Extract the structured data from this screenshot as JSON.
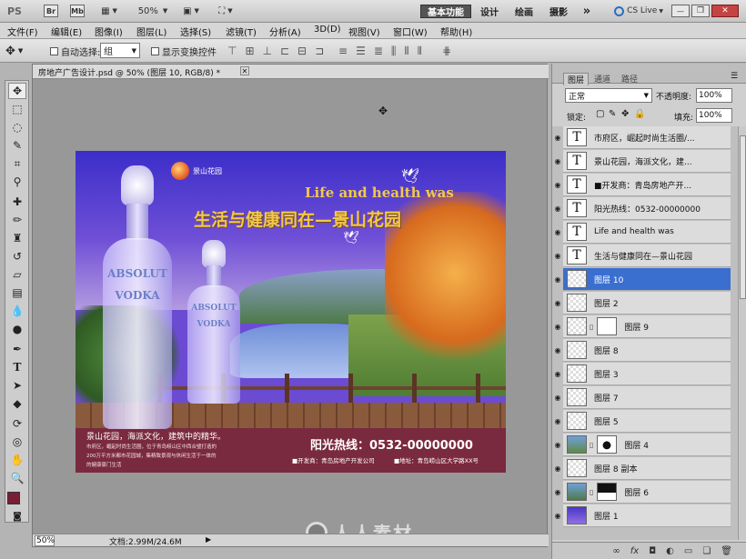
{
  "appbar": {
    "logo": "PS",
    "br": "Br",
    "mb": "Mb",
    "zoom": "50%",
    "workspaces": [
      "基本功能",
      "设计",
      "绘画",
      "摄影"
    ],
    "more": "»",
    "cslive": "CS Live",
    "min": "—",
    "restore": "❐",
    "close": "✕"
  },
  "menu": [
    "文件(F)",
    "编辑(E)",
    "图像(I)",
    "图层(L)",
    "选择(S)",
    "滤镜(T)",
    "分析(A)",
    "3D(D)",
    "视图(V)",
    "窗口(W)",
    "帮助(H)"
  ],
  "options": {
    "auto_select_label": "自动选择:",
    "auto_select_value": "组",
    "show_transform_label": "显示变换控件"
  },
  "doc": {
    "tab_title": "房地产广告设计.psd @ 50% (图层 10, RGB/8) *",
    "tab_close": "✕",
    "zoom": "50%",
    "doc_size": "文档:2.99M/24.6M"
  },
  "ad": {
    "logo_text": "景山花园",
    "headline_en": "Life and health was",
    "headline_cn": "生活与健康同在—景山花园",
    "bottle_big_brand": "ABSOLUT",
    "bottle_big_sub": "VODKA",
    "bottle_small_brand": "ABSOLUT",
    "bottle_small_sub": "VODKA",
    "slogan": "景山花园，海派文化，建筑中的精华。",
    "desc_lines": [
      "市府区，崛起时尚生活圈，位于青岛崂山区中西合璧打造的",
      "200万平方米都市花园城，集精致景观与休闲生活于一体的",
      "的健康豪门生活"
    ],
    "hotline": "阳光热线：0532-00000000",
    "developer": "■开发商：青岛房地产开发公司",
    "address": "■地址：青岛崂山区大学路XX号"
  },
  "panel": {
    "tabs": [
      "图层",
      "通道",
      "路径"
    ],
    "blend_mode": "正常",
    "opacity_label": "不透明度:",
    "opacity_value": "100%",
    "lock_label": "锁定:",
    "fill_label": "填充:",
    "fill_value": "100%",
    "layers": [
      {
        "name": "市府区，崛起时尚生活圈/...",
        "kind": "text"
      },
      {
        "name": "景山花园，海派文化，建...",
        "kind": "text"
      },
      {
        "name": "■开发商：青岛房地产开...",
        "kind": "text"
      },
      {
        "name": "阳光热线：0532-00000000",
        "kind": "text"
      },
      {
        "name": "Life and health was",
        "kind": "text"
      },
      {
        "name": "生活与健康同在—景山花园",
        "kind": "text"
      },
      {
        "name": "图层 10",
        "kind": "pixel",
        "selected": true
      },
      {
        "name": "图层 2",
        "kind": "pixel"
      },
      {
        "name": "图层 9",
        "kind": "mask"
      },
      {
        "name": "图层 8",
        "kind": "pixel"
      },
      {
        "name": "图层 3",
        "kind": "pixel"
      },
      {
        "name": "图层 7",
        "kind": "pixel"
      },
      {
        "name": "图层 5",
        "kind": "pixel"
      },
      {
        "name": "图层 4",
        "kind": "mask"
      },
      {
        "name": "图层 8 副本",
        "kind": "pixel"
      },
      {
        "name": "图层 6",
        "kind": "mask"
      },
      {
        "name": "图层 1",
        "kind": "pixel"
      }
    ],
    "footer_icons": [
      "link-icon",
      "fx-icon",
      "mask-icon",
      "adjustment-icon",
      "folder-icon",
      "new-layer-icon",
      "trash-icon"
    ]
  },
  "watermark": "人人素材",
  "colors": {
    "selected": "#3a6fd0",
    "canvas_sky": "#6c4bd3",
    "bottom_band": "#7a2a3e",
    "headline": "#f2c84a",
    "foreground": "#7a1f33"
  }
}
